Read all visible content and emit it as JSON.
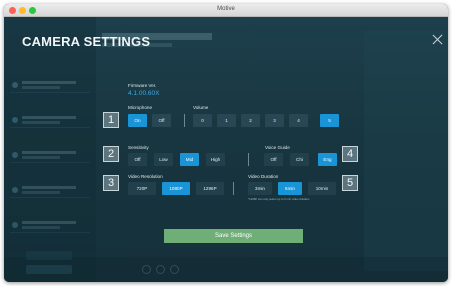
{
  "window": {
    "title": "Motive"
  },
  "modal": {
    "title": "CAMERA SETTINGS",
    "close_icon": "close-icon"
  },
  "firmware": {
    "label": "Firmware Ver.",
    "version": "4.1.00.60X"
  },
  "microphone": {
    "label": "Microphone",
    "options": [
      "On",
      "Off"
    ],
    "selected": "On"
  },
  "volume": {
    "label": "Volume",
    "options": [
      "0",
      "1",
      "2",
      "3",
      "4",
      "5"
    ],
    "selected": "5"
  },
  "sensitivity": {
    "label": "Sensitivity",
    "options": [
      "Off",
      "Low",
      "Mid",
      "High"
    ],
    "selected": "Mid"
  },
  "voice_guide": {
    "label": "Voice Guide",
    "options": [
      "Off",
      "Chi",
      "Eng"
    ],
    "selected": "Eng"
  },
  "video_resolution": {
    "label": "Video Resolution",
    "options": [
      "720P",
      "1080P",
      "1296P"
    ],
    "selected": "1080P"
  },
  "video_duration": {
    "label": "Video Duration",
    "options": [
      "3min",
      "5min",
      "10min"
    ],
    "selected": "5min",
    "note": "*1296P can only select up to 5 min video duration"
  },
  "callouts": [
    "1",
    "2",
    "3",
    "4",
    "5"
  ],
  "save_button": {
    "label": "Save Settings"
  },
  "colors": {
    "accent": "#1994d6",
    "save": "#6fae77",
    "panel": "#1b3742",
    "firmware_text": "#3aa9e4"
  }
}
